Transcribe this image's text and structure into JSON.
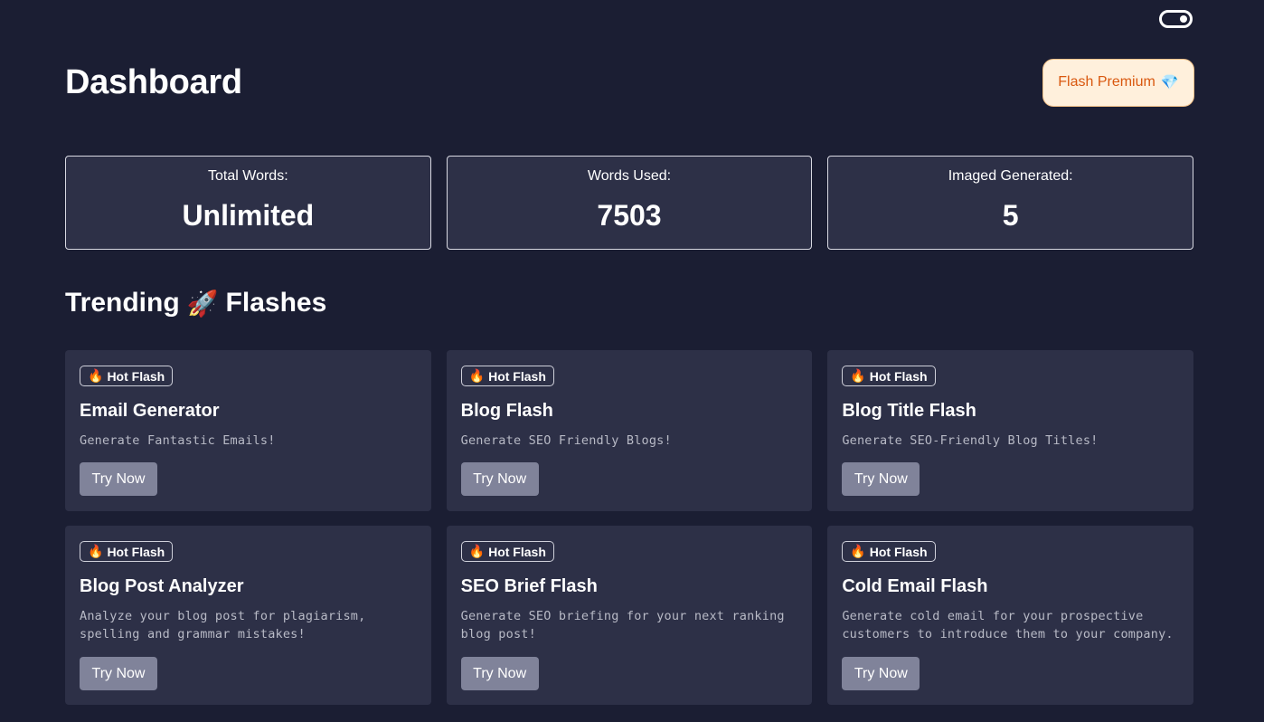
{
  "header": {
    "title": "Dashboard",
    "premium_label": "Flash Premium",
    "premium_icon": "gem-icon"
  },
  "stats": [
    {
      "label": "Total Words:",
      "value": "Unlimited"
    },
    {
      "label": "Words Used:",
      "value": "7503"
    },
    {
      "label": "Imaged Generated:",
      "value": "5"
    }
  ],
  "trending": {
    "title_before": "Trending",
    "title_icon": "rocket-icon",
    "title_after": "Flashes"
  },
  "badge_label": "Hot Flash",
  "cards": [
    {
      "title": "Email Generator",
      "description": "Generate Fantastic Emails!",
      "button": "Try Now"
    },
    {
      "title": "Blog Flash",
      "description": "Generate SEO Friendly Blogs!",
      "button": "Try Now"
    },
    {
      "title": "Blog Title Flash",
      "description": "Generate SEO-Friendly Blog Titles!",
      "button": "Try Now"
    },
    {
      "title": "Blog Post Analyzer",
      "description": "Analyze your blog post for plagiarism, spelling and grammar mistakes!",
      "button": "Try Now"
    },
    {
      "title": "SEO Brief Flash",
      "description": "Generate SEO briefing for your next ranking blog post!",
      "button": "Try Now"
    },
    {
      "title": "Cold Email Flash",
      "description": "Generate cold email for your prospective customers to introduce them to your company.",
      "button": "Try Now"
    }
  ],
  "colors": {
    "background": "#1b1e33",
    "card": "#2d3047",
    "premium_bg": "#fff0dc",
    "premium_text": "#d9580f",
    "button": "#80839a"
  }
}
